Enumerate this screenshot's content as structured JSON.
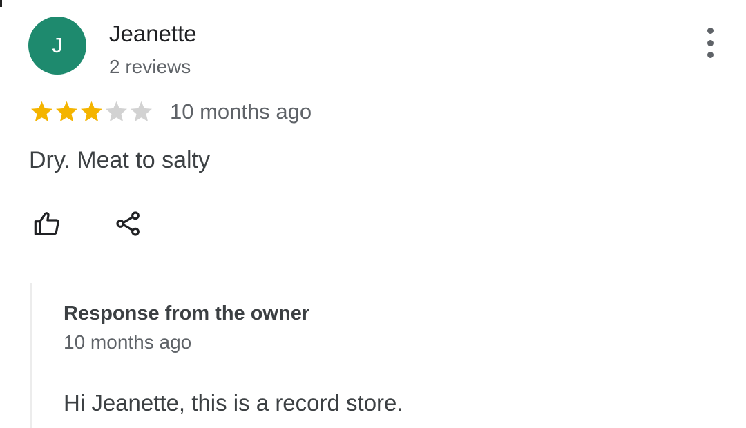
{
  "review": {
    "author": {
      "initial": "J",
      "name": "Jeanette",
      "meta": "2 reviews",
      "avatar_color": "#1e8a6e"
    },
    "rating": {
      "stars": 3,
      "max_stars": 5,
      "filled_color": "#f4b400",
      "empty_color": "#d2d2d2"
    },
    "date": "10 months ago",
    "text": "Dry. Meat to salty",
    "actions": {
      "like_icon": "thumbs-up-icon",
      "share_icon": "share-icon",
      "more_icon": "more-vert-icon"
    }
  },
  "owner_response": {
    "title": "Response from the owner",
    "date": "10 months ago",
    "text": "Hi Jeanette, this is a record store."
  }
}
